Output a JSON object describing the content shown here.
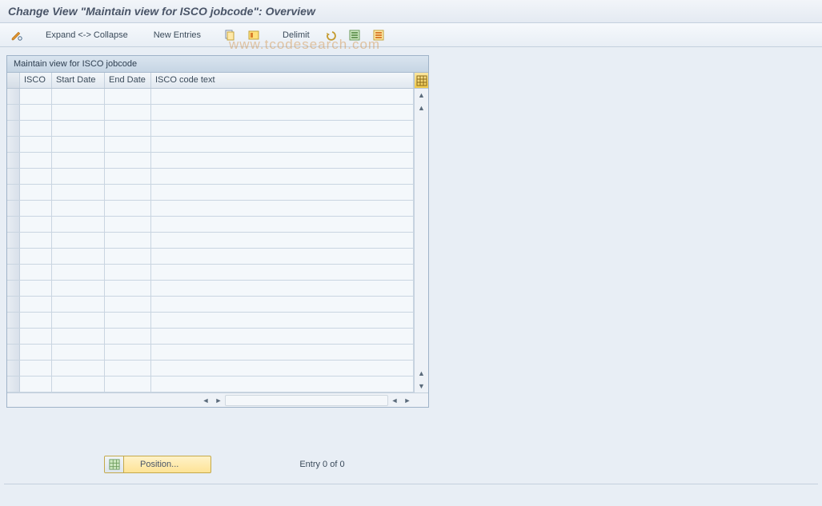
{
  "title": "Change View \"Maintain view for ISCO jobcode\": Overview",
  "toolbar": {
    "expand_collapse": "Expand <-> Collapse",
    "new_entries": "New Entries",
    "delimit": "Delimit"
  },
  "panel": {
    "header": "Maintain view for ISCO jobcode"
  },
  "columns": {
    "isco": "ISCO",
    "start_date": "Start Date",
    "end_date": "End Date",
    "isco_text": "ISCO code text"
  },
  "rows": [
    {
      "isco": "",
      "start": "",
      "end": "",
      "text": ""
    },
    {
      "isco": "",
      "start": "",
      "end": "",
      "text": ""
    },
    {
      "isco": "",
      "start": "",
      "end": "",
      "text": ""
    },
    {
      "isco": "",
      "start": "",
      "end": "",
      "text": ""
    },
    {
      "isco": "",
      "start": "",
      "end": "",
      "text": ""
    },
    {
      "isco": "",
      "start": "",
      "end": "",
      "text": ""
    },
    {
      "isco": "",
      "start": "",
      "end": "",
      "text": ""
    },
    {
      "isco": "",
      "start": "",
      "end": "",
      "text": ""
    },
    {
      "isco": "",
      "start": "",
      "end": "",
      "text": ""
    },
    {
      "isco": "",
      "start": "",
      "end": "",
      "text": ""
    },
    {
      "isco": "",
      "start": "",
      "end": "",
      "text": ""
    },
    {
      "isco": "",
      "start": "",
      "end": "",
      "text": ""
    },
    {
      "isco": "",
      "start": "",
      "end": "",
      "text": ""
    },
    {
      "isco": "",
      "start": "",
      "end": "",
      "text": ""
    },
    {
      "isco": "",
      "start": "",
      "end": "",
      "text": ""
    },
    {
      "isco": "",
      "start": "",
      "end": "",
      "text": ""
    },
    {
      "isco": "",
      "start": "",
      "end": "",
      "text": ""
    },
    {
      "isco": "",
      "start": "",
      "end": "",
      "text": ""
    },
    {
      "isco": "",
      "start": "",
      "end": "",
      "text": ""
    }
  ],
  "footer": {
    "position_label": "Position...",
    "entry_info": "Entry 0 of 0"
  },
  "watermark": "www.tcodesearch.com",
  "icons": {
    "pencil": "pencil-icon",
    "copy": "copy-icon",
    "copy2": "copy-highlight-icon",
    "undo": "undo-icon",
    "select_all": "select-all-icon",
    "select_block": "select-block-icon",
    "config": "table-settings-icon",
    "grid": "grid-icon"
  }
}
